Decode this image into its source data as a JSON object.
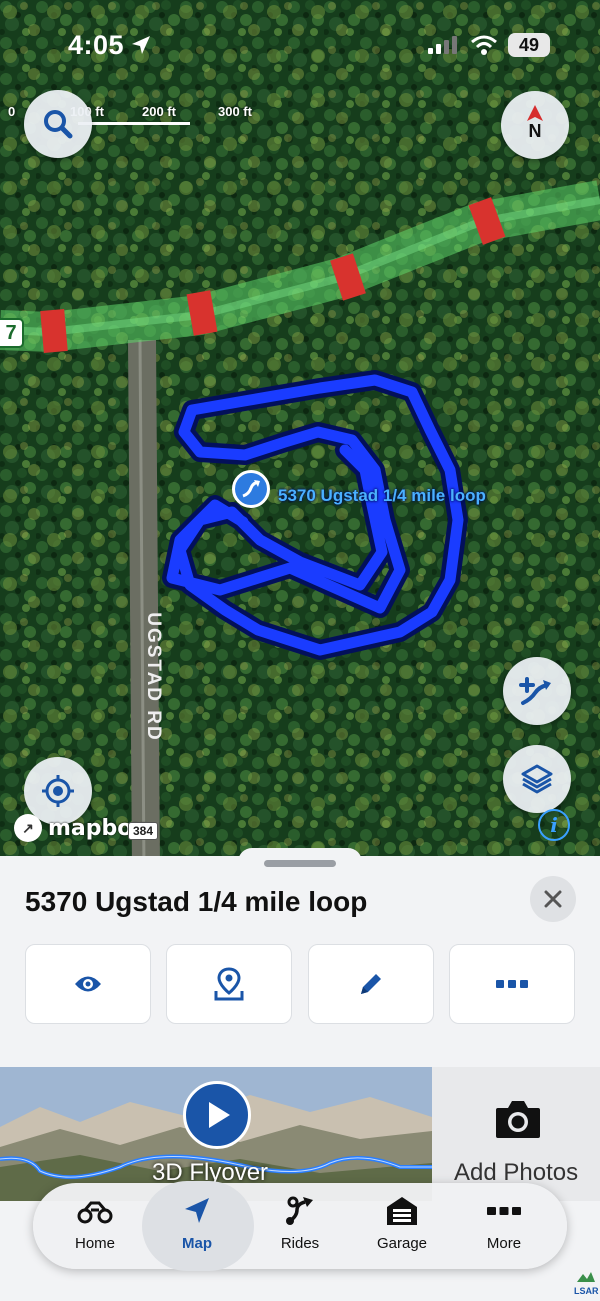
{
  "status_bar": {
    "time": "4:05",
    "battery": "49"
  },
  "map": {
    "scale_labels": [
      "0",
      "100 ft",
      "200 ft",
      "300 ft"
    ],
    "compass_label": "N",
    "route_label": "5370 Ugstad 1/4 mile loop",
    "road_label": "UGSTAD RD",
    "road_number": "384",
    "trail_sign": "7",
    "attribution": "mapbox",
    "colors": {
      "route": "#1a3cff",
      "trail": "#5ed36a",
      "trail_marker": "#d8332e"
    }
  },
  "sheet": {
    "title": "5370 Ugstad 1/4 mile loop",
    "actions": [
      {
        "icon": "eye-icon"
      },
      {
        "icon": "map-pin-icon"
      },
      {
        "icon": "pencil-icon"
      },
      {
        "icon": "more-icon"
      }
    ],
    "flyover_label": "3D Flyover",
    "add_photos_label": "Add Photos"
  },
  "tabbar": {
    "tabs": [
      {
        "label": "Home",
        "icon": "atv-icon"
      },
      {
        "label": "Map",
        "icon": "navigation-arrow-icon",
        "active": true
      },
      {
        "label": "Rides",
        "icon": "route-icon"
      },
      {
        "label": "Garage",
        "icon": "garage-icon"
      },
      {
        "label": "More",
        "icon": "more-icon"
      }
    ]
  },
  "corner_logo": "LSAR"
}
